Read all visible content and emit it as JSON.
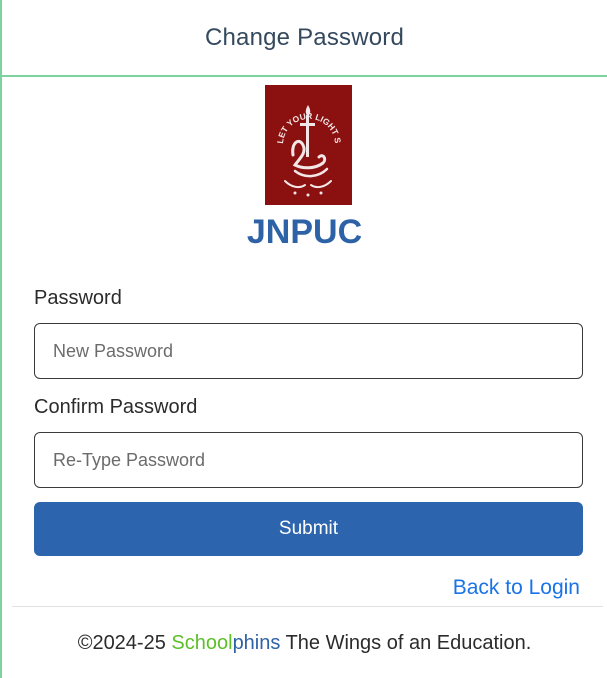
{
  "header": {
    "title": "Change Password"
  },
  "logo": {
    "icon": "school-crest-icon",
    "motto": "LET YOUR LIGHT SHINE",
    "background_color": "#8b1111"
  },
  "org": {
    "name": "JNPUC"
  },
  "form": {
    "password_label": "Password",
    "password_placeholder": "New Password",
    "password_value": "",
    "confirm_label": "Confirm Password",
    "confirm_placeholder": "Re-Type Password",
    "confirm_value": "",
    "submit_label": "Submit"
  },
  "links": {
    "back_to_login": "Back to Login"
  },
  "footer": {
    "copyright": "©2024-25",
    "brand_part1": "School",
    "brand_part2": "phins",
    "tagline": "The Wings of an Education."
  },
  "colors": {
    "accent_border": "#7dd3a0",
    "primary": "#2c64ad",
    "brand_green": "#5cbf2a",
    "brand_blue": "#2e62a6",
    "link": "#1a73e8"
  }
}
